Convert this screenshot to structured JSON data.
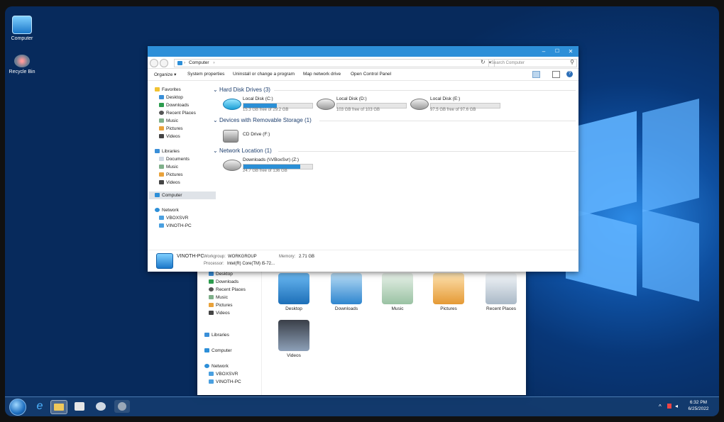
{
  "desktop": {
    "icons": [
      {
        "label": "Computer",
        "icon": "computer-monitor-icon"
      },
      {
        "label": "Recycle Bin",
        "icon": "recycle-bin-icon"
      }
    ]
  },
  "back_window": {
    "nav": {
      "favorites": [
        "Desktop",
        "Downloads",
        "Recent Places",
        "Music",
        "Pictures",
        "Videos"
      ],
      "libraries": "Libraries",
      "computer": "Computer",
      "network": "Network",
      "network_items": [
        "VBOXSVR",
        "VINOTH-PC"
      ]
    },
    "tiles": [
      {
        "label": "Desktop",
        "color": "#3a8fd8"
      },
      {
        "label": "Downloads",
        "color": "#4ea3e8"
      },
      {
        "label": "Music",
        "color": "#9fc6a8"
      },
      {
        "label": "Pictures",
        "color": "#f0b050"
      },
      {
        "label": "Recent Places",
        "color": "#c9d3dc"
      },
      {
        "label": "Videos",
        "color": "#6a7f9a"
      }
    ]
  },
  "explorer": {
    "address": {
      "path": "Computer",
      "separator": "›",
      "search_placeholder": "Search Computer"
    },
    "window_buttons": {
      "minimize": "–",
      "maximize": "☐",
      "close": "✕"
    },
    "toolbar": [
      "Organize",
      "System properties",
      "Uninstall or change a program",
      "Map network drive",
      "Open Control Panel"
    ],
    "nav": {
      "favorites_header": "Favorites",
      "favorites": [
        "Desktop",
        "Downloads",
        "Recent Places",
        "Music",
        "Pictures",
        "Videos"
      ],
      "libraries_header": "Libraries",
      "libraries": [
        "Documents",
        "Music",
        "Pictures",
        "Videos"
      ],
      "computer": "Computer",
      "network_header": "Network",
      "network_items": [
        "VBOXSVR",
        "VINOTH-PC"
      ]
    },
    "sections": {
      "hdd": "Hard Disk Drives (3)",
      "removable": "Devices with Removable Storage (1)",
      "network": "Network Location (1)"
    },
    "drives": [
      {
        "name": "Local Disk (C:)",
        "free": "15.3 GB free of 29.2 GB",
        "used_fraction": 0.48
      },
      {
        "name": "Local Disk (D:)",
        "free": "103 GB free of 103 GB",
        "used_fraction": 0.0
      },
      {
        "name": "Local Disk (E:)",
        "free": "97.5 GB free of 97.6 GB",
        "used_fraction": 0.0
      }
    ],
    "removable": [
      {
        "name": "CD Drive (F:)"
      }
    ],
    "network_locations": [
      {
        "name": "Downloads (\\\\VBoxSvr) (Z:)",
        "free": "24.7 GB free of 136 GB",
        "used_fraction": 0.82
      }
    ],
    "details": {
      "pc_name": "VINOTH-PC",
      "workgroup_label": "Workgroup:",
      "workgroup": "WORKGROUP",
      "memory_label": "Memory:",
      "memory": "2.71 GB",
      "processor_label": "Processor:",
      "processor": "Intel(R) Core(TM) i5-72..."
    }
  },
  "taskbar": {
    "time": "6:32 PM",
    "date": "6/25/2022",
    "tray": "^"
  },
  "colors": {
    "titlebar": "#2d8fd8",
    "accent": "#2a8fd6",
    "taskbar": "#143c6e"
  }
}
